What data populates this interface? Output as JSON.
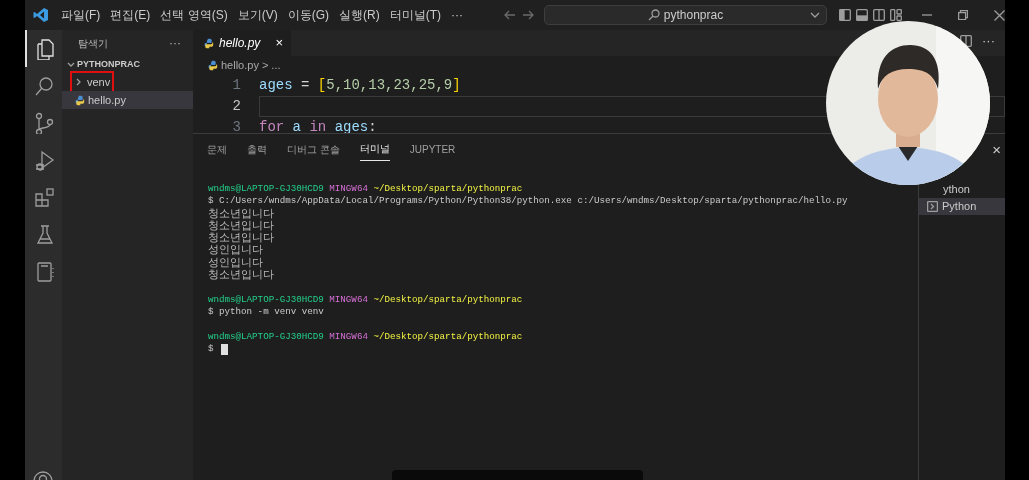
{
  "window": {
    "search": "pythonprac"
  },
  "menu": [
    "파일(F)",
    "편집(E)",
    "선택 영역(S)",
    "보기(V)",
    "이동(G)",
    "실행(R)",
    "터미널(T)",
    "···"
  ],
  "sidebar": {
    "title": "탐색기",
    "more": "···",
    "folder": {
      "label": "PYTHONPRAC",
      "expanded": true,
      "children": [
        {
          "label": "venv",
          "kind": "folder",
          "expanded": false,
          "selected": false,
          "highlighted": true
        },
        {
          "label": "hello.py",
          "kind": "python",
          "selected": true,
          "highlighted": false
        }
      ]
    }
  },
  "tabs": [
    {
      "label": "hello.py",
      "selected": true,
      "close": "×"
    }
  ],
  "editor_actions": {
    "more": "···"
  },
  "breadcrumb": {
    "file": "hello.py",
    "separator": ">",
    "rest": "..."
  },
  "code": [
    {
      "number": "1",
      "active": false,
      "tokens": [
        {
          "text": "ages",
          "kind": "variable"
        },
        {
          "text": " = ",
          "kind": "operator"
        },
        {
          "text": "[",
          "kind": "bracket"
        },
        {
          "text": "5,10,13,23,25,9",
          "kind": "number"
        },
        {
          "text": "]",
          "kind": "bracket"
        }
      ]
    },
    {
      "number": "2",
      "active": true
    },
    {
      "number": "3",
      "active": false,
      "tokens": [
        {
          "text": "for",
          "kind": "keyword"
        },
        {
          "text": " a ",
          "kind": "variable"
        },
        {
          "text": "in",
          "kind": "keyword"
        },
        {
          "text": " ages",
          "kind": "variable"
        },
        {
          "text": ":",
          "kind": "operator"
        }
      ]
    }
  ],
  "panel": {
    "tabs": [
      {
        "label": "문제",
        "selected": false
      },
      {
        "label": "출력",
        "selected": false
      },
      {
        "label": "디버그 콘솔",
        "selected": false
      },
      {
        "label": "터미널",
        "selected": true
      },
      {
        "label": "JUPYTER",
        "selected": false
      }
    ],
    "close": "×"
  },
  "terminal": {
    "lines": [
      {
        "kind": "prompt",
        "user": "wndms@LAPTOP-GJ30HCD9",
        "shell": "MINGW64",
        "path": "~/Desktop/sparta/pythonprac"
      },
      {
        "kind": "command",
        "text": "$ C:/Users/wndms/AppData/Local/Programs/Python/Python38/python.exe c:/Users/wndms/Desktop/sparta/pythonprac/hello.py"
      },
      {
        "kind": "output",
        "text": "청소년입니다"
      },
      {
        "kind": "output",
        "text": "청소년입니다"
      },
      {
        "kind": "output",
        "text": "청소년입니다"
      },
      {
        "kind": "output",
        "text": "성인입니다"
      },
      {
        "kind": "output",
        "text": "성인입니다"
      },
      {
        "kind": "output",
        "text": "청소년입니다"
      },
      {
        "kind": "blank"
      },
      {
        "kind": "prompt",
        "user": "wndms@LAPTOP-GJ30HCD9",
        "shell": "MINGW64",
        "path": "~/Desktop/sparta/pythonprac"
      },
      {
        "kind": "command",
        "text": "$ python -m venv venv"
      },
      {
        "kind": "blank"
      },
      {
        "kind": "prompt",
        "user": "wndms@LAPTOP-GJ30HCD9",
        "shell": "MINGW64",
        "path": "~/Desktop/sparta/pythonprac"
      },
      {
        "kind": "input",
        "text": "$",
        "cursor": true
      }
    ]
  },
  "terminal_list": [
    {
      "label": "ython",
      "selected": false
    },
    {
      "label": "Python",
      "selected": true
    }
  ]
}
